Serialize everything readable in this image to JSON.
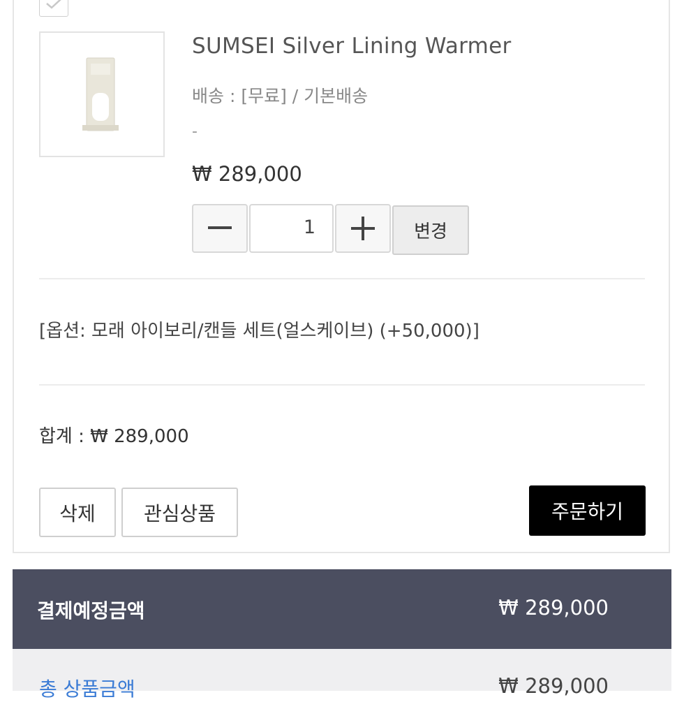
{
  "product": {
    "name": "SUMSEI Silver Lining Warmer",
    "shipping": "배송 : [무료] / 기본배송",
    "dash": "-",
    "price": "₩ 289,000",
    "quantity": "1",
    "change_label": "변경"
  },
  "option": {
    "text": "[옵션: 모래 아이보리/캔들 세트(얼스케이브) (+50,000)]"
  },
  "summary": {
    "total": "합계 : ₩ 289,000"
  },
  "actions": {
    "delete_label": "삭제",
    "wishlist_label": "관심상품",
    "order_label": "주문하기"
  },
  "payment": {
    "label": "결제예정금액",
    "amount": "₩ 289,000"
  },
  "subtotal": {
    "label": "총 상품금액",
    "amount": "₩ 289,000"
  },
  "icons": {
    "checkbox": "checkmark-icon",
    "minus": "minus-icon",
    "plus": "plus-icon"
  },
  "colors": {
    "payment_bar": "#4b4e60",
    "order_button": "#000000",
    "link_blue": "#3a7bd5"
  }
}
